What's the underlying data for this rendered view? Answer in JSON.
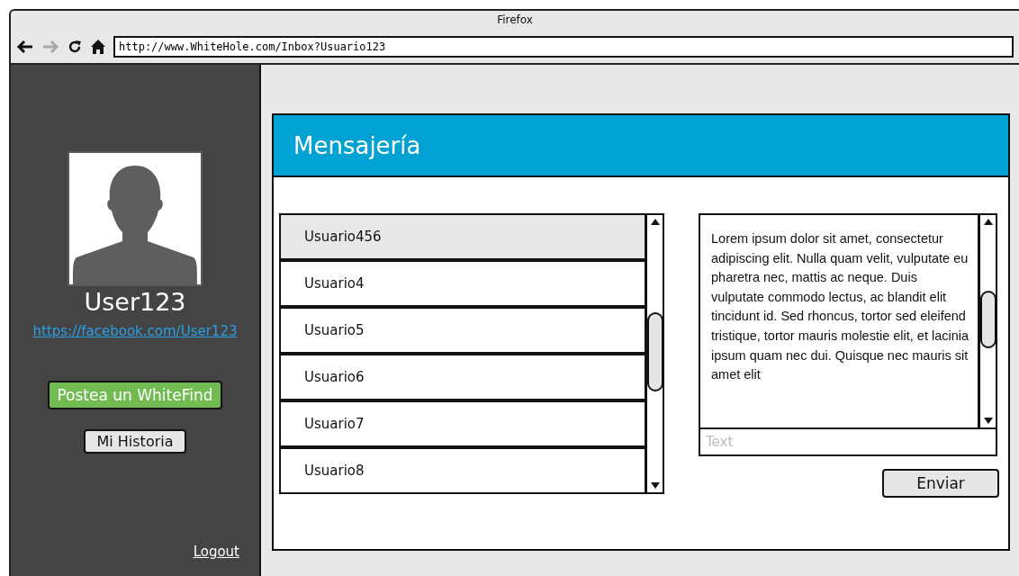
{
  "window": {
    "title": "Firefox"
  },
  "toolbar": {
    "url": "http://www.WhiteHole.com/Inbox?Usuario123"
  },
  "sidebar": {
    "username": "User123",
    "profile_link": "https://facebook.com/User123",
    "primary_button": "Postea un WhiteFind",
    "secondary_button": "Mi Historia",
    "logout": "Logout"
  },
  "panel": {
    "title": "Mensajería",
    "contacts": [
      {
        "name": "Usuario456",
        "selected": true
      },
      {
        "name": "Usuario4",
        "selected": false
      },
      {
        "name": "Usuario5",
        "selected": false
      },
      {
        "name": "Usuario6",
        "selected": false
      },
      {
        "name": "Usuario7",
        "selected": false
      },
      {
        "name": "Usuario8",
        "selected": false
      }
    ],
    "message": "Lorem ipsum dolor sit amet, consectetur adipiscing elit. Nulla quam velit, vulputate eu pharetra nec, mattis ac neque. Duis vulputate commodo lectus, ac blandit elit tincidunt id. Sed rhoncus, tortor sed eleifend tristique, tortor mauris molestie elit, et lacinia ipsum quam nec dui. Quisque nec mauris sit amet elit",
    "reply_placeholder": "Text",
    "send_button": "Enviar"
  }
}
